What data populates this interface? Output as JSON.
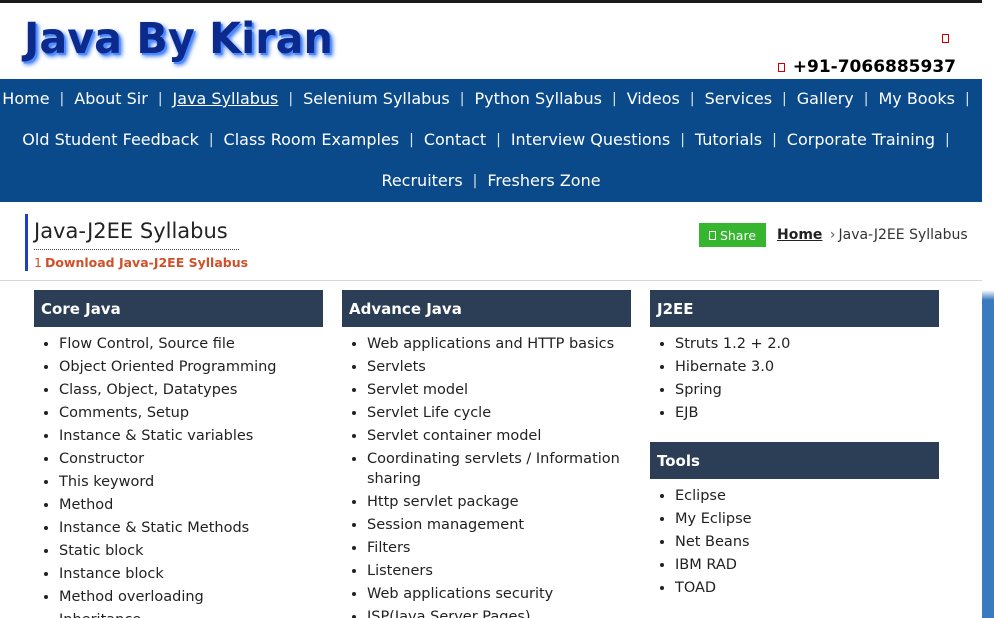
{
  "header": {
    "logo_text": "Java By Kiran",
    "phone": "+91-7066885937"
  },
  "nav": {
    "row1": [
      "Home",
      "About Sir",
      "Java Syllabus",
      "Selenium Syllabus",
      "Python Syllabus",
      "Videos",
      "Services",
      "Gallery",
      "My Books"
    ],
    "row2": [
      "Old Student Feedback",
      "Class Room Examples",
      "Contact",
      "Interview Questions",
      "Tutorials",
      "Corporate Training"
    ],
    "row3": [
      "Recruiters",
      "Freshers Zone"
    ],
    "active": "Java Syllabus",
    "separator": "|"
  },
  "title_block": {
    "title": "Java-J2EE Syllabus",
    "download_num": "1",
    "download_label": "Download Java-J2EE Syllabus"
  },
  "share": {
    "label": "Share"
  },
  "breadcrumb": {
    "home": "Home",
    "separator": "›",
    "current": "Java-J2EE Syllabus"
  },
  "sections": {
    "core_java": {
      "title": "Core Java",
      "items": [
        "Flow Control, Source file",
        "Object Oriented Programming",
        "Class, Object, Datatypes",
        "Comments, Setup",
        "Instance & Static variables",
        "Constructor",
        "This keyword",
        "Method",
        "Instance & Static Methods",
        "Static block",
        "Instance block",
        "Method overloading",
        "Inheritance"
      ]
    },
    "advance_java": {
      "title": "Advance Java",
      "items": [
        "Web applications and HTTP basics",
        "Servlets",
        "Servlet model",
        "Servlet Life cycle",
        "Servlet container model",
        "Coordinating servlets / Information sharing",
        "Http servlet package",
        "Session management",
        "Filters",
        "Listeners",
        "Web applications security",
        "JSP(Java Server Pages)"
      ]
    },
    "j2ee": {
      "title": "J2EE",
      "items": [
        "Struts 1.2 + 2.0",
        "Hibernate 3.0",
        "Spring",
        "EJB"
      ]
    },
    "tools": {
      "title": "Tools",
      "items": [
        "Eclipse",
        "My Eclipse",
        "Net Beans",
        "IBM RAD",
        "TOAD"
      ]
    }
  },
  "colors": {
    "nav_bg": "#0a4a8a",
    "section_header_bg": "#2c3e56",
    "share_bg": "#36b52f",
    "download_link": "#d0502a",
    "logo": "#0b2a8c"
  }
}
